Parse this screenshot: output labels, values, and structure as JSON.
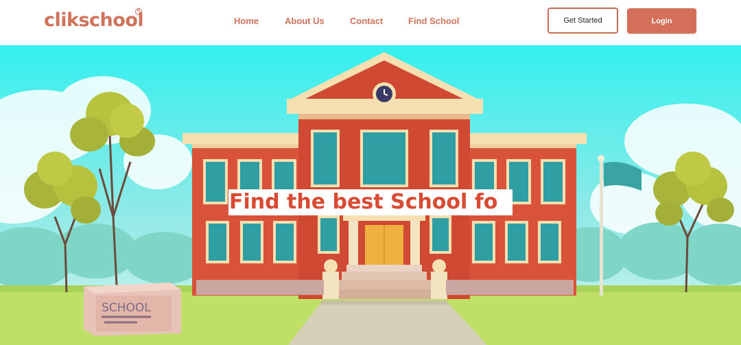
{
  "brand": {
    "name": "clikschool",
    "reg_mark": "R"
  },
  "nav": {
    "links": [
      {
        "label": "Home"
      },
      {
        "label": "About Us"
      },
      {
        "label": "Contact"
      },
      {
        "label": "Find School"
      }
    ],
    "get_started_label": "Get Started",
    "login_label": "Login"
  },
  "hero": {
    "heading": "Find the best School fo",
    "sign_text": "SCHOOL"
  },
  "colors": {
    "brand": "#d0735a",
    "heading": "#d84a31",
    "login_bg": "#d4705a",
    "building": "#d9523a",
    "sky_top": "#3ef0f0",
    "grass": "#bfe066"
  }
}
